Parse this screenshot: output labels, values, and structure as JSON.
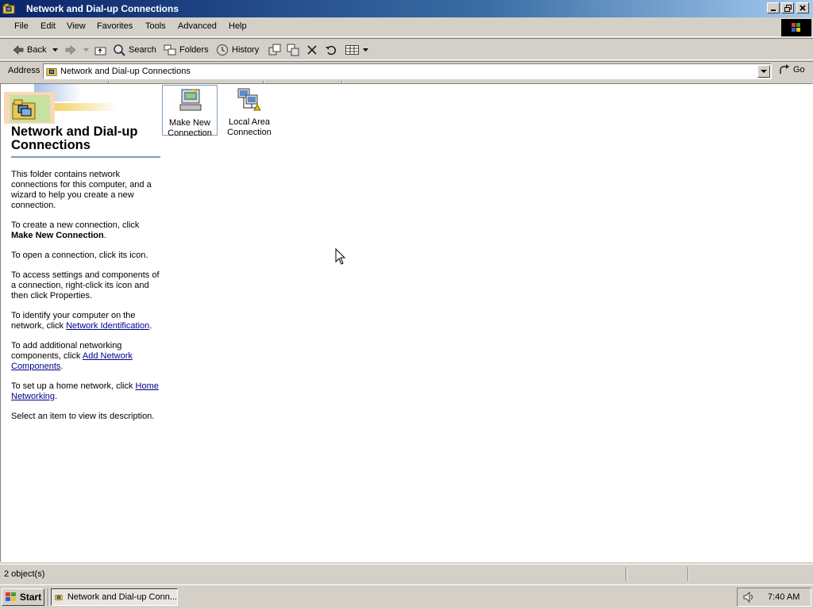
{
  "window": {
    "title": "Network and Dial-up Connections"
  },
  "menu": {
    "items": [
      "File",
      "Edit",
      "View",
      "Favorites",
      "Tools",
      "Advanced",
      "Help"
    ]
  },
  "toolbar": {
    "back": "Back",
    "search": "Search",
    "folders": "Folders",
    "history": "History"
  },
  "address": {
    "label": "Address",
    "value": "Network and Dial-up Connections",
    "go": "Go"
  },
  "panel": {
    "title": "Network and Dial-up Connections",
    "p1": "This folder contains network connections for this computer, and a wizard to help you create a new connection.",
    "p2_pre": "To create a new connection, click",
    "p2_bold": "Make New Connection",
    "p3": "To open a connection, click its icon.",
    "p4": "To access settings and components of a connection, right-click its icon and then click Properties.",
    "p5_pre": "To identify your computer on the network, click",
    "p5_link": "Network Identification",
    "p6_pre": "To add additional networking components, click",
    "p6_link": "Add Network Components",
    "p7_pre": "To set up a home network, click",
    "p7_link": "Home Networking",
    "p8": "Select an item to view its description.",
    "period": "."
  },
  "items": [
    {
      "line1": "Make New",
      "line2": "Connection"
    },
    {
      "line1": "Local Area",
      "line2": "Connection"
    }
  ],
  "status": {
    "text": "2 object(s)"
  },
  "taskbar": {
    "start": "Start",
    "task": "Network and Dial-up Conn...",
    "clock": "7:40 AM"
  },
  "colors": {
    "title_gradient_start": "#0a246a",
    "title_gradient_end": "#a6caf0",
    "face": "#d4d0c8",
    "link": "#00008b"
  }
}
